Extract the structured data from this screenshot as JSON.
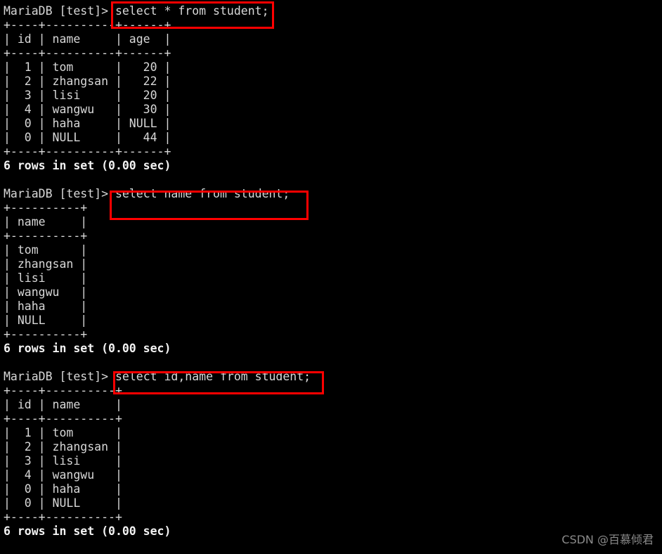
{
  "terminal": {
    "background_color": "#000000",
    "text_color": "#d8d8d8",
    "highlight_color": "#ff0000",
    "prompt": "MariaDB [test]> "
  },
  "blocks": [
    {
      "id": "block-select-star",
      "prompt": "MariaDB [test]> ",
      "command": "select * from student;",
      "table": {
        "border_top": "+----+----------+------+",
        "header_row": "| id | name     | age  |",
        "border_mid": "+----+----------+------+",
        "rows": [
          "|  1 | tom      |   20 |",
          "|  2 | zhangsan |   22 |",
          "|  3 | lisi     |   20 |",
          "|  4 | wangwu   |   30 |",
          "|  0 | haha     | NULL |",
          "|  0 | NULL     |   44 |"
        ],
        "border_bottom": "+----+----------+------+"
      },
      "status": "6 rows in set (0.00 sec)"
    },
    {
      "id": "block-select-name",
      "prompt": "MariaDB [test]> ",
      "command": "select name from student;",
      "table": {
        "border_top": "+----------+",
        "header_row": "| name     |",
        "border_mid": "+----------+",
        "rows": [
          "| tom      |",
          "| zhangsan |",
          "| lisi     |",
          "| wangwu   |",
          "| haha     |",
          "| NULL     |"
        ],
        "border_bottom": "+----------+"
      },
      "status": "6 rows in set (0.00 sec)"
    },
    {
      "id": "block-select-id-name",
      "prompt": "MariaDB [test]> ",
      "command": "select id,name from student;",
      "table": {
        "border_top": "+----+----------+",
        "header_row": "| id | name     |",
        "border_mid": "+----+----------+",
        "rows": [
          "|  1 | tom      |",
          "|  2 | zhangsan |",
          "|  3 | lisi     |",
          "|  4 | wangwu   |",
          "|  0 | haha     |",
          "|  0 | NULL     |"
        ],
        "border_bottom": "+----+----------+"
      },
      "status": "6 rows in set (0.00 sec)"
    }
  ],
  "query_results": {
    "columns": [
      "id",
      "name",
      "age"
    ],
    "rows": [
      {
        "id": "1",
        "name": "tom",
        "age": "20"
      },
      {
        "id": "2",
        "name": "zhangsan",
        "age": "22"
      },
      {
        "id": "3",
        "name": "lisi",
        "age": "20"
      },
      {
        "id": "4",
        "name": "wangwu",
        "age": "30"
      },
      {
        "id": "0",
        "name": "haha",
        "age": "NULL"
      },
      {
        "id": "0",
        "name": "NULL",
        "age": "44"
      }
    ],
    "row_count": "6",
    "elapsed": "0.00 sec"
  },
  "watermark": "CSDN @百慕倾君"
}
